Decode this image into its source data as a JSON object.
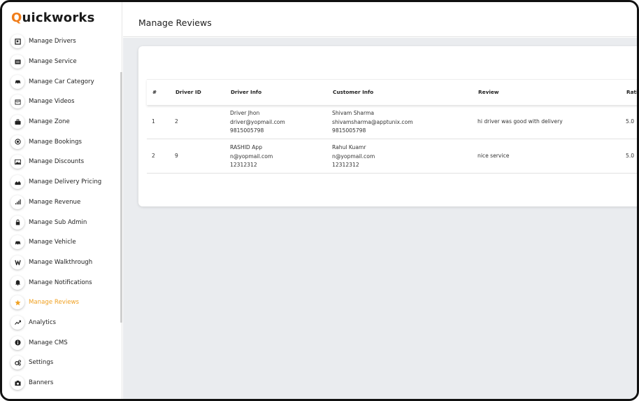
{
  "app": {
    "logo_q": "Q",
    "logo_rest": "uickworks"
  },
  "sidebar": {
    "items": [
      {
        "label": "Manage Drivers",
        "icon": "driver-icon"
      },
      {
        "label": "Manage Service",
        "icon": "service-icon"
      },
      {
        "label": "Manage Car Category",
        "icon": "car-icon"
      },
      {
        "label": "Manage Videos",
        "icon": "calendar-icon"
      },
      {
        "label": "Manage Zone",
        "icon": "briefcase-icon"
      },
      {
        "label": "Manage Bookings",
        "icon": "target-icon"
      },
      {
        "label": "Manage Discounts",
        "icon": "image-icon"
      },
      {
        "label": "Manage Delivery Pricing",
        "icon": "area-chart-icon"
      },
      {
        "label": "Manage Revenue",
        "icon": "bar-chart-icon"
      },
      {
        "label": "Manage Sub Admin",
        "icon": "lock-icon"
      },
      {
        "label": "Manage Vehicle",
        "icon": "car-icon"
      },
      {
        "label": "Manage Walkthrough",
        "icon": "walkthrough-icon"
      },
      {
        "label": "Manage Notifications",
        "icon": "bell-icon"
      },
      {
        "label": "Manage Reviews",
        "icon": "star-icon",
        "active": true
      },
      {
        "label": "Analytics",
        "icon": "trend-icon"
      },
      {
        "label": "Manage CMS",
        "icon": "info-icon"
      },
      {
        "label": "Settings",
        "icon": "gears-icon"
      },
      {
        "label": "Banners",
        "icon": "camera-icon"
      }
    ]
  },
  "header": {
    "title": "Manage Reviews"
  },
  "table": {
    "columns": [
      "#",
      "Driver ID",
      "Driver Info",
      "Customer Info",
      "Review",
      "Rati"
    ],
    "rows": [
      {
        "num": "1",
        "driver_id": "2",
        "driver_name": "Driver Jhon",
        "driver_email": "driver@yopmail.com",
        "driver_phone": "9815005798",
        "customer_name": "Shivam Sharma",
        "customer_email": "shivamsharma@apptunix.com",
        "customer_phone": "9815005798",
        "review": "hi driver was good with delivery",
        "rating": "5.0"
      },
      {
        "num": "2",
        "driver_id": "9",
        "driver_name": "RASHID App",
        "driver_email": "n@yopmail.com",
        "driver_phone": "12312312",
        "customer_name": "Rahul Kuamr",
        "customer_email": "n@yopmail.com",
        "customer_phone": "12312312",
        "review": "nice service",
        "rating": "5.0"
      }
    ]
  },
  "colors": {
    "accent": "#f07d1a",
    "active": "#f0a020",
    "background": "#eaecef"
  }
}
